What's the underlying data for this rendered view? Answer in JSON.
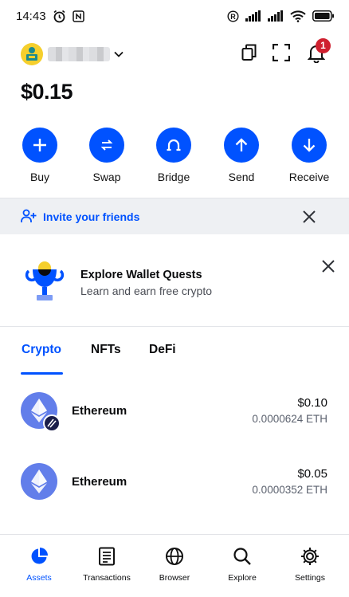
{
  "status_bar": {
    "time": "14:43"
  },
  "header": {
    "notification_count": "1"
  },
  "balance": "$0.15",
  "actions": [
    {
      "label": "Buy",
      "icon": "plus-icon"
    },
    {
      "label": "Swap",
      "icon": "swap-icon"
    },
    {
      "label": "Bridge",
      "icon": "bridge-icon"
    },
    {
      "label": "Send",
      "icon": "arrow-up-icon"
    },
    {
      "label": "Receive",
      "icon": "arrow-down-icon"
    }
  ],
  "invite": {
    "text": "Invite your friends"
  },
  "quest": {
    "title": "Explore Wallet Quests",
    "subtitle": "Learn and earn free crypto"
  },
  "tabs": [
    {
      "label": "Crypto",
      "active": true
    },
    {
      "label": "NFTs",
      "active": false
    },
    {
      "label": "DeFi",
      "active": false
    }
  ],
  "assets": [
    {
      "name": "Ethereum",
      "fiat": "$0.10",
      "amount": "0.0000624 ETH"
    },
    {
      "name": "Ethereum",
      "fiat": "$0.05",
      "amount": "0.0000352 ETH"
    }
  ],
  "bottom_nav": [
    {
      "label": "Assets",
      "icon": "pie-chart-icon",
      "active": true
    },
    {
      "label": "Transactions",
      "icon": "document-icon",
      "active": false
    },
    {
      "label": "Browser",
      "icon": "globe-icon",
      "active": false
    },
    {
      "label": "Explore",
      "icon": "search-icon",
      "active": false
    },
    {
      "label": "Settings",
      "icon": "gear-icon",
      "active": false
    }
  ],
  "colors": {
    "primary": "#0052ff",
    "badge": "#cf202f",
    "eth": "#627eea",
    "banner_bg": "#eef0f3"
  }
}
